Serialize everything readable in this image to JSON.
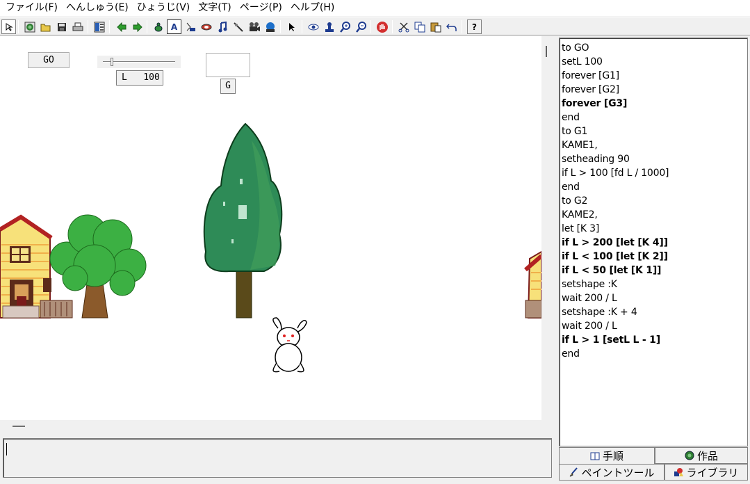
{
  "menu": [
    "ファイル(F)",
    "へんしゅう(E)",
    "ひょうじ(V)",
    "文字(T)",
    "ページ(P)",
    "ヘルプ(H)"
  ],
  "toolbar": {
    "help_label": "?",
    "text_tool_label": "A"
  },
  "canvas": {
    "go_button": "GO",
    "slider_readout": "L   100",
    "slider_value": 100,
    "g_button": "G"
  },
  "code_lines": [
    {
      "text": "to GO",
      "bold": false
    },
    {
      "text": "setL 100",
      "bold": false
    },
    {
      "text": "forever [G1]",
      "bold": false
    },
    {
      "text": "forever [G2]",
      "bold": false
    },
    {
      "text": "forever [G3]",
      "bold": true
    },
    {
      "text": "end",
      "bold": false
    },
    {
      "text": "to G1",
      "bold": false
    },
    {
      "text": "KAME1,",
      "bold": false
    },
    {
      "text": "setheading 90",
      "bold": false
    },
    {
      "text": "if L > 100 [fd L / 1000]",
      "bold": false
    },
    {
      "text": "end",
      "bold": false
    },
    {
      "text": "to G2",
      "bold": false
    },
    {
      "text": "KAME2,",
      "bold": false
    },
    {
      "text": "let [K 3]",
      "bold": false
    },
    {
      "text": "if L > 200 [let [K 4]]",
      "bold": true
    },
    {
      "text": "if L < 100 [let [K 2]]",
      "bold": true
    },
    {
      "text": "if L < 50 [let [K 1]]",
      "bold": true
    },
    {
      "text": "setshape :K",
      "bold": false
    },
    {
      "text": "wait 200 / L",
      "bold": false
    },
    {
      "text": "setshape :K + 4",
      "bold": false
    },
    {
      "text": "wait 200 / L",
      "bold": false
    },
    {
      "text": "if L > 1 [setL L - 1]",
      "bold": true
    },
    {
      "text": "end",
      "bold": false
    }
  ],
  "tabs": {
    "procedures": "手順",
    "works": "作品",
    "paint_tool": "ペイントツール",
    "library": "ライブラリ"
  },
  "colors": {
    "tree_dark_green": "#2e8b57",
    "tree_light_green": "#3cb043",
    "house_yellow": "#f7e17a",
    "roof_red": "#b22222"
  }
}
